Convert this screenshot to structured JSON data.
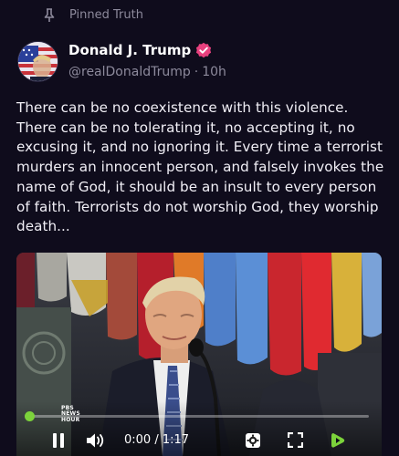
{
  "pinned": {
    "label": "Pinned Truth"
  },
  "author": {
    "name": "Donald J. Trump",
    "handle": "@realDonaldTrump",
    "separator": "·",
    "time": "10h"
  },
  "post": {
    "text": "There can be no coexistence with this violence. There can be no tolerating it, no accepting it, no excusing it, and no ignoring it. Every time a terrorist murders an innocent person, and falsely invokes the name of God, it should be an insult to every person of faith. Terrorists do not worship God, they worship death..."
  },
  "video": {
    "watermark_lines": [
      "PBS",
      "NEWS",
      "HOUR"
    ],
    "current_time": "0:00",
    "duration": "1:17",
    "time_separator": " / ",
    "progress_fraction": 0.0,
    "accent_color": "#7cd33b"
  },
  "colors": {
    "background": "#0f0c1c",
    "muted_text": "#8d8a9c",
    "verified_badge": "#e8407e"
  },
  "icons": {
    "pin": "pin-icon",
    "verified": "verified-badge-icon",
    "pause": "pause-icon",
    "volume": "volume-icon",
    "settings": "gear-icon",
    "fullscreen": "fullscreen-icon",
    "rumble": "rumble-logo-icon"
  }
}
